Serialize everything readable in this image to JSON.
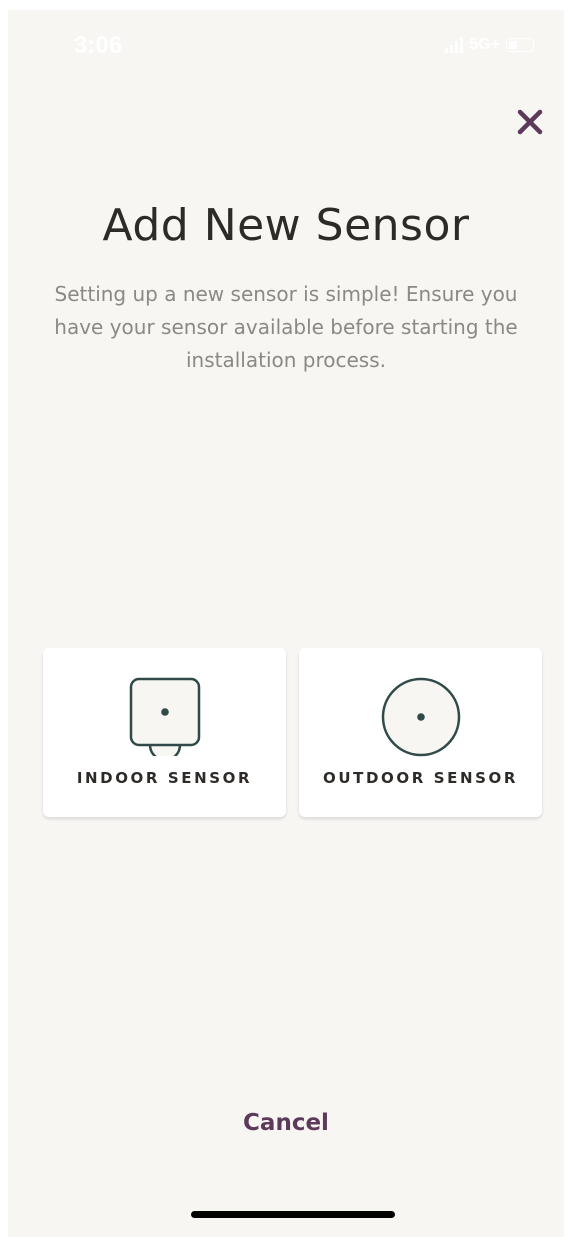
{
  "status_bar": {
    "time": "3:06",
    "network": "5G+",
    "battery_level": 0.4
  },
  "header": {
    "close_icon": "close-icon"
  },
  "title": "Add New Sensor",
  "subtitle": "Setting up a new sensor is simple! Ensure you have your sensor available before starting the installation process.",
  "sensor_options": [
    {
      "label": "INDOOR SENSOR",
      "icon": "indoor-sensor-icon"
    },
    {
      "label": "OUTDOOR SENSOR",
      "icon": "outdoor-sensor-icon"
    }
  ],
  "cancel_label": "Cancel",
  "colors": {
    "background": "#f7f6f3",
    "accent": "#5e3a5a",
    "icon_stroke": "#2f4a48",
    "title_text": "#2e2a28",
    "body_text": "#8c8885",
    "card": "#ffffff"
  }
}
